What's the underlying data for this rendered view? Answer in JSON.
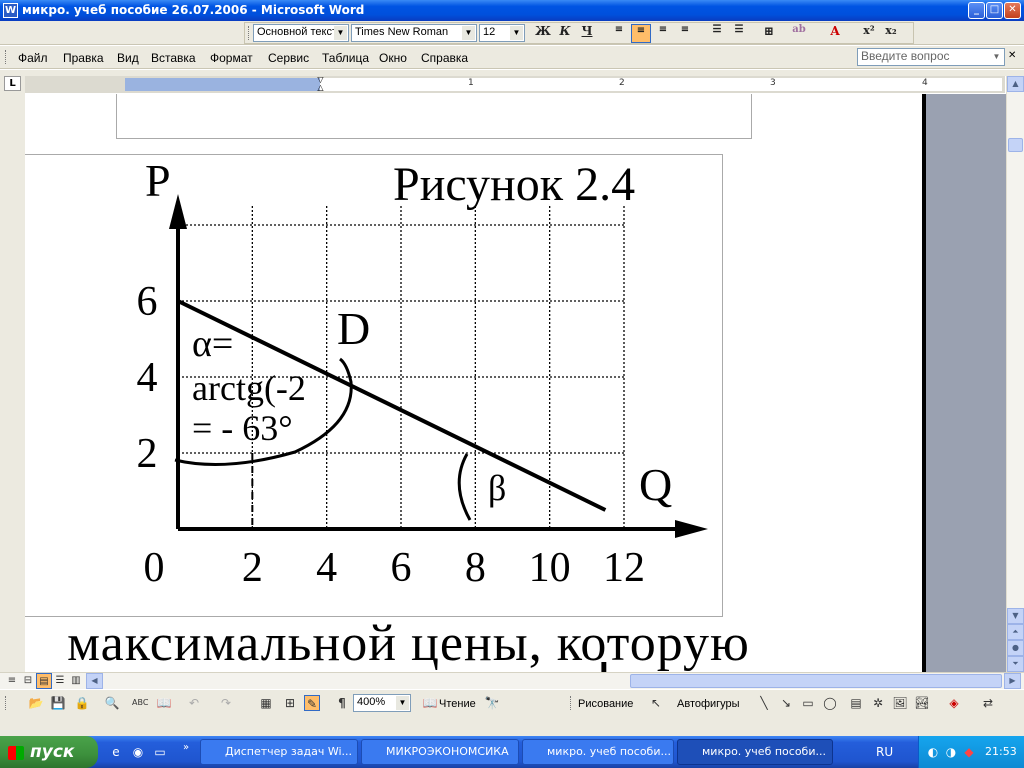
{
  "window": {
    "title": "микро. учеб пособие 26.07.2006 - Microsoft Word",
    "min": "_",
    "max": "□",
    "close": "✕"
  },
  "format_toolbar": {
    "style": "Основной текст",
    "font": "Times New Roman",
    "size": "12",
    "bold": "Ж",
    "italic": "К",
    "underline": "Ч"
  },
  "menu": {
    "items": [
      "Файл",
      "Правка",
      "Вид",
      "Вставка",
      "Формат",
      "Сервис",
      "Таблица",
      "Окно",
      "Справка"
    ],
    "help_placeholder": "Введите вопрос"
  },
  "ruler": {
    "tab": "L",
    "numbers": [
      "1",
      "1",
      "2",
      "3",
      "4"
    ]
  },
  "figure": {
    "title": "Рисунок 2.4",
    "p_label": "P",
    "q_label": "Q",
    "point_label": "D",
    "alpha_line1": "α=",
    "alpha_line2": "arctg(-2",
    "alpha_line3": "= - 63°",
    "beta_label": "β"
  },
  "chart_data": {
    "type": "line",
    "x_ticks": [
      "0",
      "2",
      "4",
      "6",
      "8",
      "10",
      "12"
    ],
    "y_ticks": [
      "2",
      "4",
      "6"
    ],
    "series": [
      {
        "x": [
          0,
          11.5
        ],
        "y": [
          6,
          0.5
        ]
      }
    ],
    "xlim": [
      0,
      12
    ],
    "ylim": [
      0,
      8.5
    ],
    "grid": true
  },
  "body_text": {
    "line1": "максимальной цены, которую",
    "line2": "Т"
  },
  "bottom_toolbar": {
    "zoom": "400%",
    "reading": "Чтение",
    "drawing": "Рисование",
    "autoshapes": "Автофигуры"
  },
  "taskbar": {
    "start": "пуск",
    "tasks": [
      "Диспетчер задач Wi...",
      "МИКРОЭКОНОМСИКА",
      "микро. учеб пособи...",
      "микро. учеб пособи..."
    ],
    "lang": "RU",
    "time": "21:53"
  }
}
